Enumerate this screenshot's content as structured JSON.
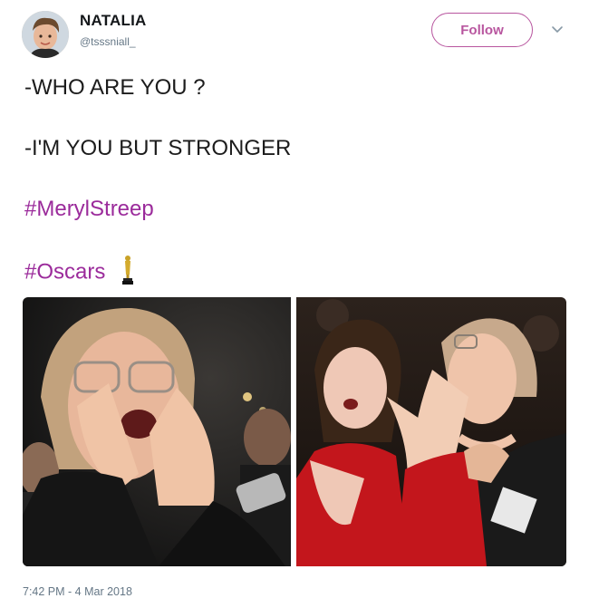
{
  "user": {
    "name": "NATALIA",
    "handle": "@tsssniall_",
    "avatar_icon": "profile-photo"
  },
  "actions": {
    "follow_label": "Follow",
    "menu_icon": "chevron-down-icon"
  },
  "tweet": {
    "lines": [
      "-WHO ARE YOU ?",
      "-I'M YOU BUT STRONGER"
    ],
    "hashtags": [
      "#MerylStreep",
      "#Oscars"
    ],
    "emoji": "oscar-trophy-icon",
    "timestamp": "7:42 PM - 4 Mar 2018"
  },
  "media": {
    "images": [
      "meryl-streep-shouting-photo",
      "meryl-streep-red-dress-cheering-photo"
    ]
  },
  "colors": {
    "accent": "#b8569f",
    "hashtag": "#9b2b9b",
    "muted": "#657786",
    "text": "#14171a"
  }
}
